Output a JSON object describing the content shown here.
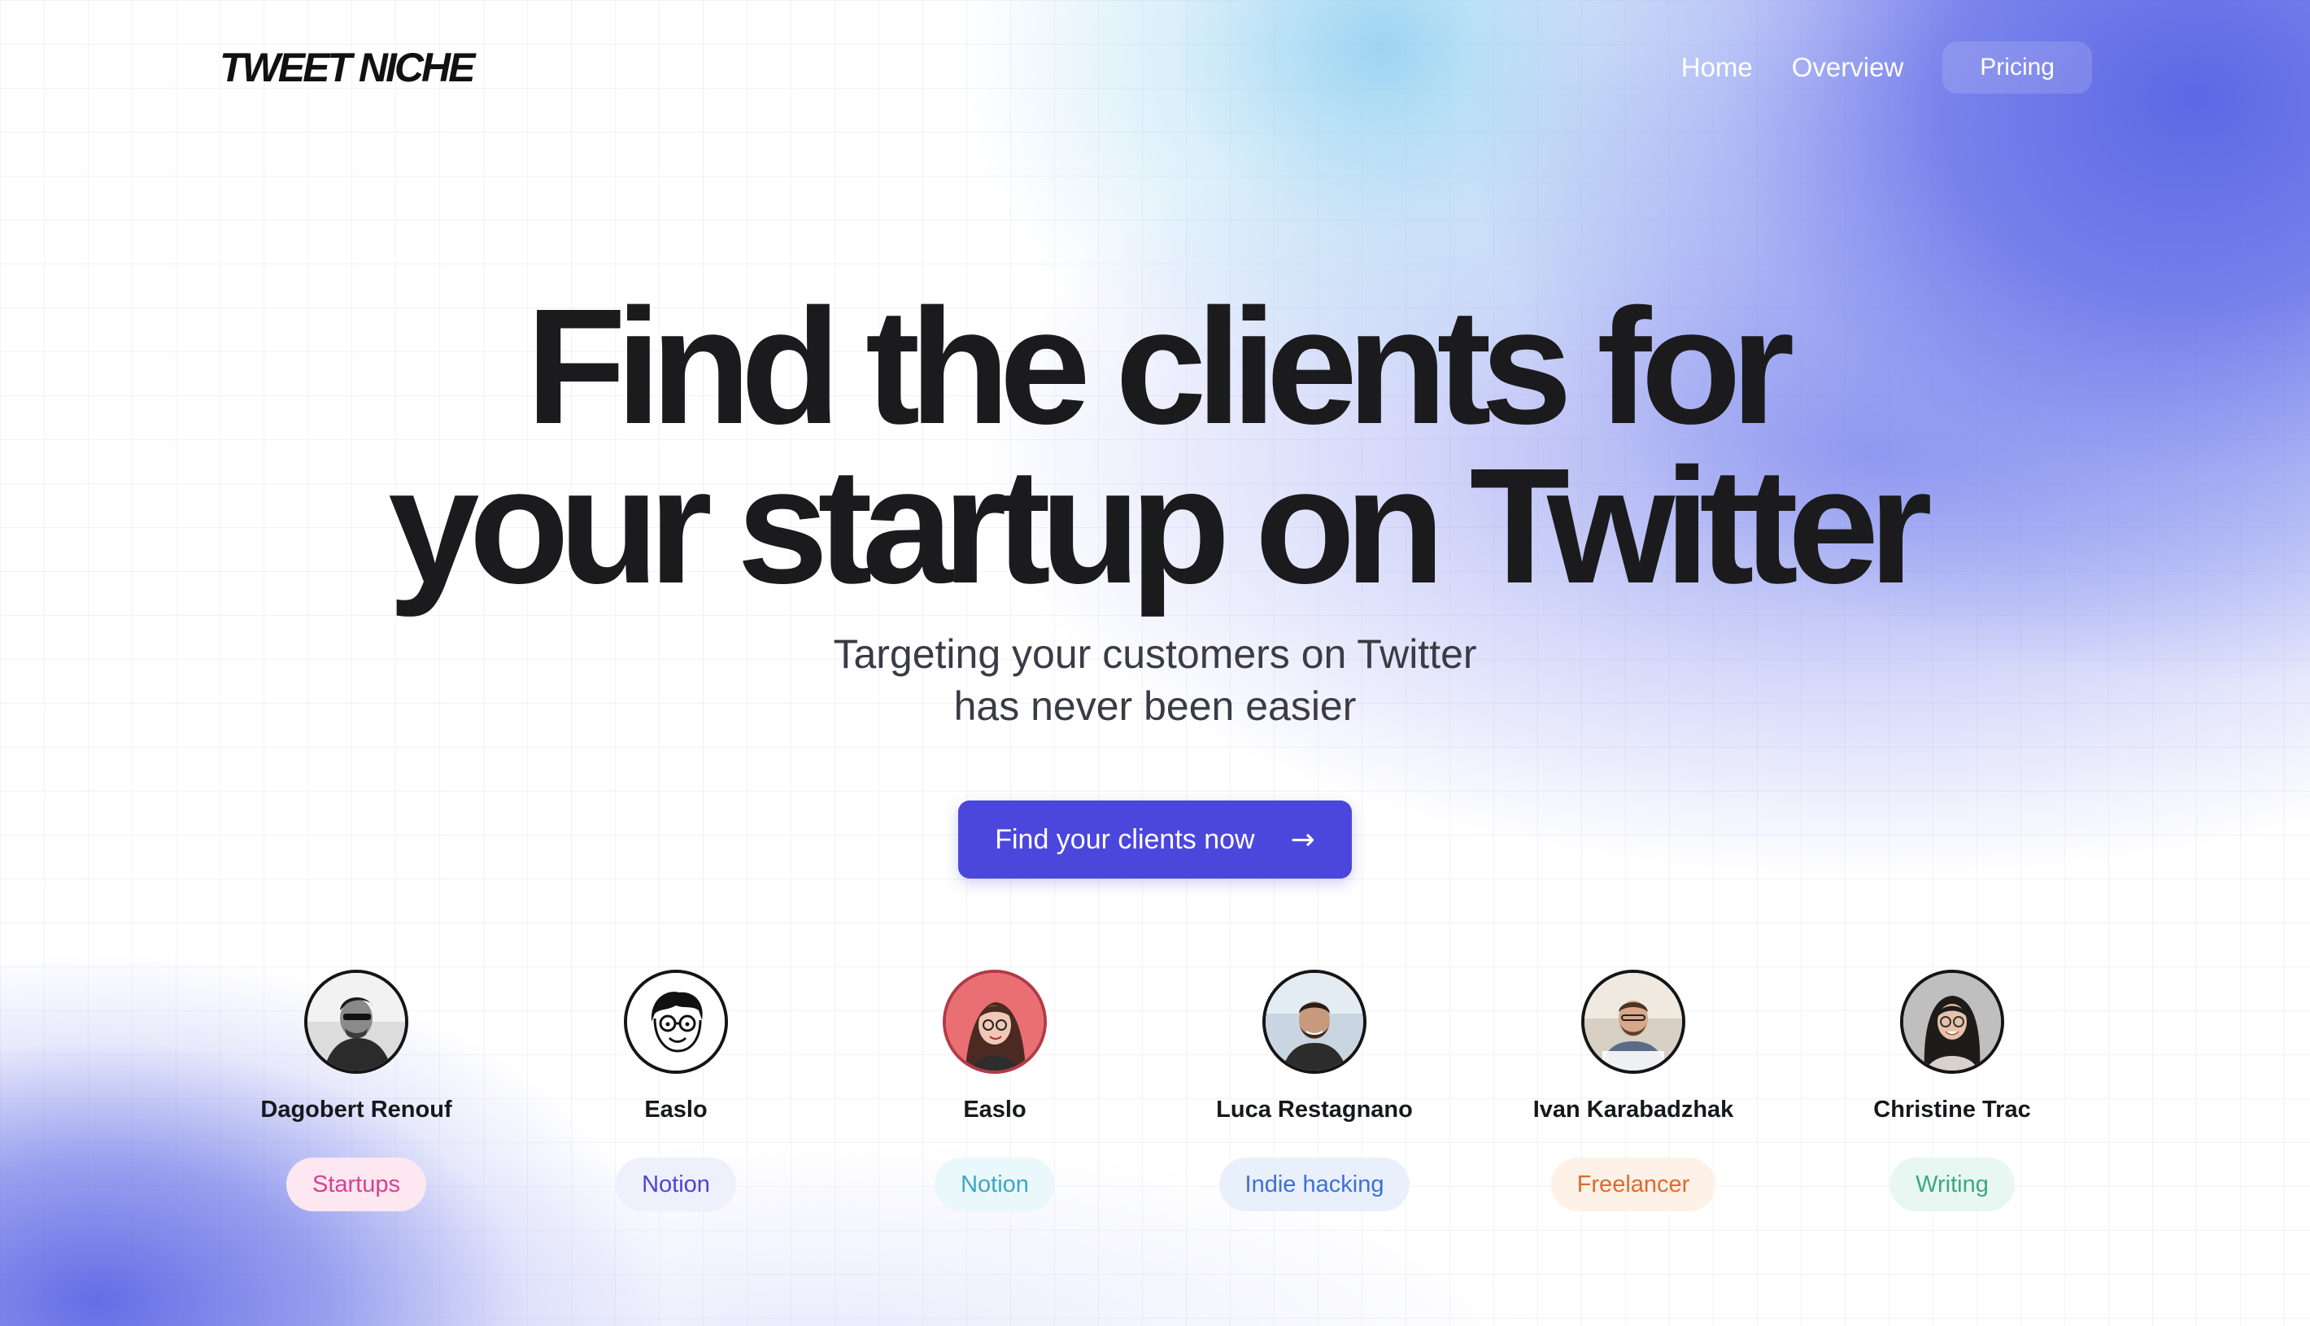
{
  "header": {
    "logo": "TWEET NICHE",
    "nav": {
      "home": "Home",
      "overview": "Overview",
      "pricing": "Pricing"
    }
  },
  "hero": {
    "title_line1": "Find the clients for",
    "title_line2": "your startup on Twitter",
    "subtitle_line1": "Targeting your customers on Twitter",
    "subtitle_line2": "has never been easier",
    "cta_label": "Find your clients now",
    "cta_arrow": "→"
  },
  "profiles": [
    {
      "name": "Dagobert Renouf",
      "tag": "Startups",
      "tag_color": "#d6418f",
      "tag_bg": "#fde7f1"
    },
    {
      "name": "Easlo",
      "tag": "Notion",
      "tag_color": "#4a44d6",
      "tag_bg": "#eef0fb"
    },
    {
      "name": "Easlo",
      "tag": "Notion",
      "tag_color": "#3aa7c3",
      "tag_bg": "#eaf8fb"
    },
    {
      "name": "Luca Restagnano",
      "tag": "Indie hacking",
      "tag_color": "#3c6fd8",
      "tag_bg": "#e9f0fc"
    },
    {
      "name": "Ivan Karabadzhak",
      "tag": "Freelancer",
      "tag_color": "#de6a2c",
      "tag_bg": "#fdf1e8"
    },
    {
      "name": "Christine Trac",
      "tag": "Writing",
      "tag_color": "#3aa886",
      "tag_bg": "#e8f7f1"
    }
  ],
  "colors": {
    "accent": "#4b47dd",
    "gradient_blue": "#6470e8"
  },
  "icons": {
    "cta_arrow": "right-arrow-icon"
  }
}
